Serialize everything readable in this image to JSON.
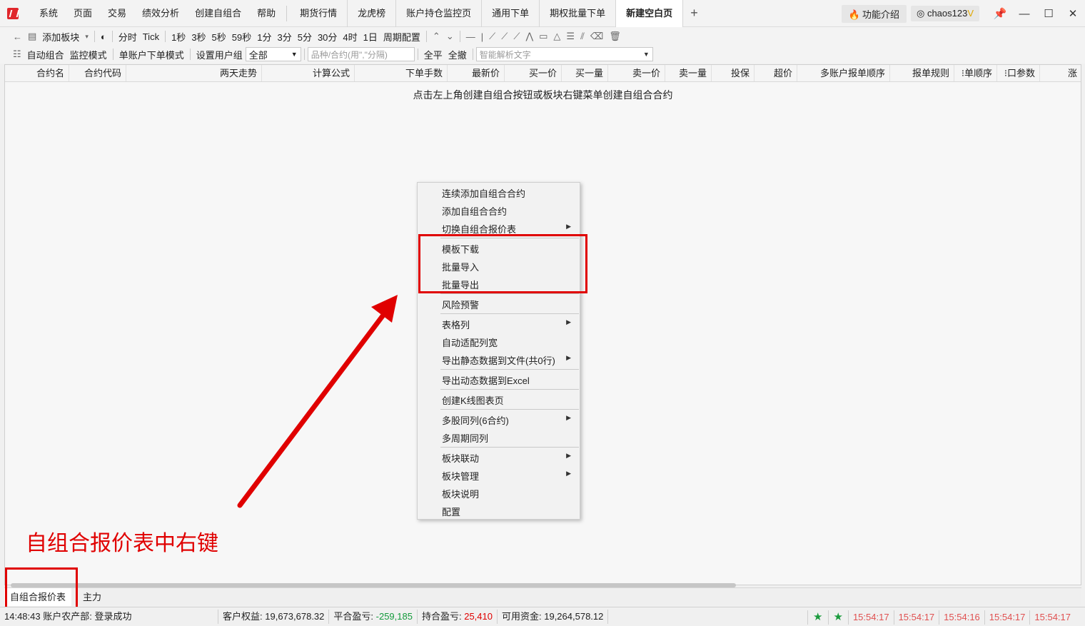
{
  "menu": [
    "系统",
    "页面",
    "交易",
    "绩效分析",
    "创建自组合",
    "帮助"
  ],
  "tabs": [
    {
      "label": "期货行情",
      "active": false
    },
    {
      "label": "龙虎榜",
      "active": false
    },
    {
      "label": "账户持仓监控页",
      "active": false
    },
    {
      "label": "通用下单",
      "active": false
    },
    {
      "label": "期权批量下单",
      "active": false
    },
    {
      "label": "新建空白页",
      "active": true
    }
  ],
  "add_tab": "+",
  "feature_intro": "功能介绍",
  "user": {
    "name": "chaos123",
    "badge": "V"
  },
  "toolbar1": {
    "add_block": "添加板块",
    "periods": [
      "分时",
      "Tick",
      "1秒",
      "3秒",
      "5秒",
      "59秒",
      "1分",
      "3分",
      "5分",
      "30分",
      "4时",
      "1日",
      "周期配置"
    ]
  },
  "toolbar2": {
    "auto_combo": "自动组合",
    "monitor_mode": "监控模式",
    "single_account_mode": "单账户下单模式",
    "set_user_group": "设置用户组",
    "group_value": "全部",
    "symbol_placeholder": "品种/合约(用\",\"分隔)",
    "close_all": "全平",
    "cancel_all": "全撤",
    "smart_parse_placeholder": "智能解析文字"
  },
  "columns": [
    "合约名",
    "合约代码",
    "两天走势",
    "计算公式",
    "下单手数",
    "最新价",
    "买一价",
    "买一量",
    "卖一价",
    "卖一量",
    "投保",
    "超价",
    "多账户报单顺序",
    "报单规则",
    "⁝单顺序",
    "⁝口参数",
    "涨"
  ],
  "empty_hint": "点击左上角创建自组合按钮或板块右键菜单创建自组合合约",
  "context_menu": [
    {
      "label": "连续添加自组合合约",
      "submenu": false
    },
    {
      "label": "添加自组合合约",
      "submenu": false
    },
    {
      "label": "切换自组合报价表",
      "submenu": true
    },
    {
      "label": "模板下载",
      "submenu": false
    },
    {
      "label": "批量导入",
      "submenu": false
    },
    {
      "label": "批量导出",
      "submenu": false
    },
    {
      "label": "风险预警",
      "submenu": false
    },
    {
      "label": "表格列",
      "submenu": true
    },
    {
      "label": "自动适配列宽",
      "submenu": false
    },
    {
      "label": "导出静态数据到文件(共0行)",
      "submenu": true
    },
    {
      "label": "导出动态数据到Excel",
      "submenu": false
    },
    {
      "label": "创建K线图表页",
      "submenu": false
    },
    {
      "label": "多股同列(6合约)",
      "submenu": true
    },
    {
      "label": "多周期同列",
      "submenu": false
    },
    {
      "label": "板块联动",
      "submenu": true
    },
    {
      "label": "板块管理",
      "submenu": true
    },
    {
      "label": "板块说明",
      "submenu": false
    },
    {
      "label": "配置",
      "submenu": false
    }
  ],
  "annotation": "自组合报价表中右键",
  "sheet_tabs": [
    {
      "label": "自组合报价表",
      "active": true
    },
    {
      "label": "主力",
      "active": false
    }
  ],
  "status": {
    "login": "14:48:43 账户农产部: 登录成功",
    "equity_label": "客户权益:",
    "equity_value": "19,673,678.32",
    "close_pnl_label": "平合盈亏:",
    "close_pnl_value": "-259,185",
    "position_pnl_label": "持合盈亏:",
    "position_pnl_value": "25,410",
    "available_label": "可用资金:",
    "available_value": "19,264,578.12",
    "times": [
      "15:54:17",
      "15:54:17",
      "15:54:16",
      "15:54:17",
      "15:54:17"
    ]
  },
  "colors": {
    "accent_red": "#e00000",
    "gain_green": "#139a3b",
    "time_red": "#e05050"
  }
}
